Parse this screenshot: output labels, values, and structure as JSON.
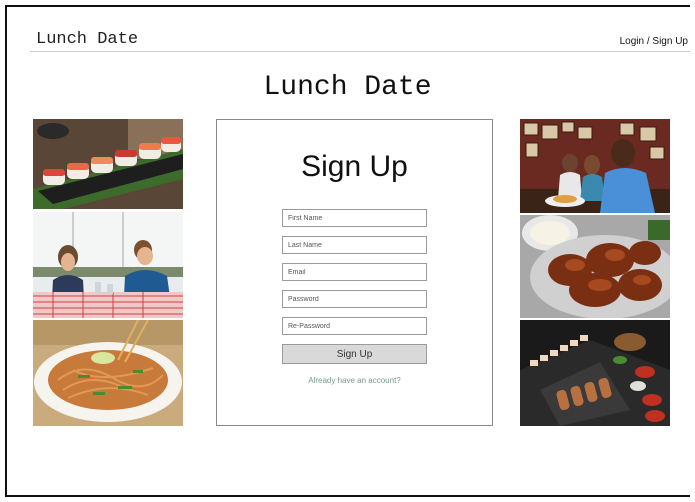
{
  "header": {
    "brand": "Lunch Date",
    "auth_link": "Login / Sign Up"
  },
  "hero": {
    "title": "Lunch Date"
  },
  "signup": {
    "title": "Sign Up",
    "fields": [
      {
        "placeholder": "First Name",
        "value": ""
      },
      {
        "placeholder": "Last Name",
        "value": ""
      },
      {
        "placeholder": "Email",
        "value": ""
      },
      {
        "placeholder": "Password",
        "value": ""
      },
      {
        "placeholder": "Re-Password",
        "value": ""
      }
    ],
    "submit_label": "Sign Up",
    "login_prompt": "Already have an account?"
  },
  "gallery": {
    "left": [
      {
        "subject": "sushi"
      },
      {
        "subject": "couple-at-cafe"
      },
      {
        "subject": "pad-thai"
      }
    ],
    "right": [
      {
        "subject": "friends-laughing-at-restaurant"
      },
      {
        "subject": "chicken-wings"
      },
      {
        "subject": "korean-bbq-spread"
      }
    ]
  }
}
